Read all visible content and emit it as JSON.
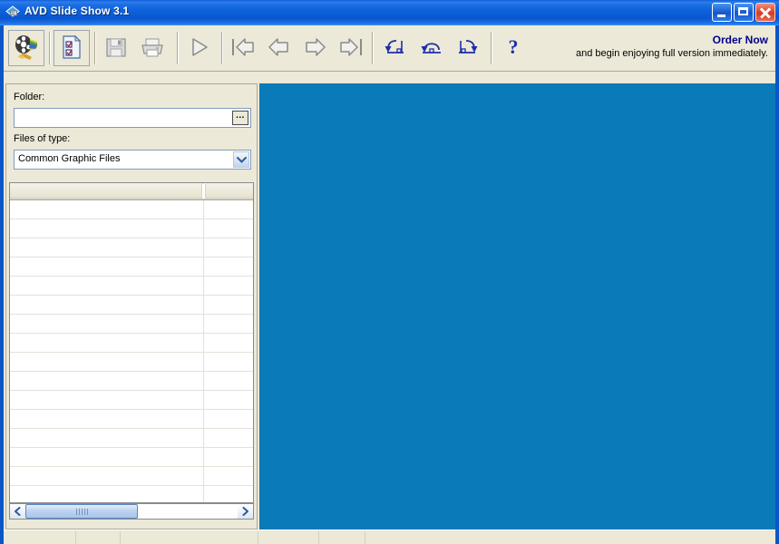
{
  "window": {
    "title": "AVD Slide Show 3.1",
    "icon": "app-diamond-icon",
    "minimize_label": "Minimize",
    "maximize_label": "Maximize",
    "close_label": "Close"
  },
  "toolbar": {
    "buttons": [
      {
        "name": "slideshow-logo-button",
        "icon": "film-reel-brush-icon",
        "label": "Slide Show",
        "enabled": true
      },
      {
        "name": "list-properties-button",
        "icon": "document-checklist-icon",
        "label": "Properties",
        "enabled": true
      },
      {
        "name": "save-button",
        "icon": "floppy-disk-icon",
        "label": "Save",
        "enabled": false
      },
      {
        "name": "print-button",
        "icon": "printer-icon",
        "label": "Print",
        "enabled": false
      },
      {
        "name": "play-button",
        "icon": "play-triangle-icon",
        "label": "Play",
        "enabled": false
      },
      {
        "name": "first-button",
        "icon": "first-arrow-icon",
        "label": "First",
        "enabled": false
      },
      {
        "name": "previous-button",
        "icon": "previous-arrow-icon",
        "label": "Previous",
        "enabled": false
      },
      {
        "name": "next-button",
        "icon": "next-arrow-icon",
        "label": "Next",
        "enabled": false
      },
      {
        "name": "last-button",
        "icon": "last-arrow-icon",
        "label": "Last",
        "enabled": false
      },
      {
        "name": "rotate-left-button",
        "icon": "rotate-left-icon",
        "label": "Rotate Left",
        "enabled": true
      },
      {
        "name": "flip-button",
        "icon": "rotate-180-icon",
        "label": "Rotate 180",
        "enabled": true
      },
      {
        "name": "rotate-right-button",
        "icon": "rotate-right-icon",
        "label": "Rotate Right",
        "enabled": true
      },
      {
        "name": "help-button",
        "icon": "question-mark-icon",
        "label": "?",
        "enabled": true
      }
    ],
    "order": {
      "title": "Order Now",
      "subtitle": "and begin enjoying full version immediately."
    }
  },
  "left_panel": {
    "folder": {
      "label": "Folder:",
      "value": "",
      "placeholder": "",
      "browse_label": "..."
    },
    "files_of_type": {
      "label": "Files of type:",
      "selected": "Common Graphic Files",
      "options": [
        "Common Graphic Files"
      ]
    },
    "file_list": {
      "columns": [
        "",
        ""
      ],
      "rows": [],
      "empty_row_count": 16
    },
    "hscrollbar": {
      "left_arrow": "◄",
      "right_arrow": "►",
      "thumb_grip": "grip-dots"
    }
  },
  "preview": {
    "background_color": "#0b7ab8",
    "image": ""
  },
  "statusbar": {
    "panels": [
      "",
      "",
      "",
      "",
      "",
      ""
    ]
  },
  "colors": {
    "title_blue": "#0a56c8",
    "face": "#ece9d8",
    "preview_blue": "#0b7ab8",
    "order_blue": "#00008b",
    "icon_blue": "#1f2fa8"
  }
}
